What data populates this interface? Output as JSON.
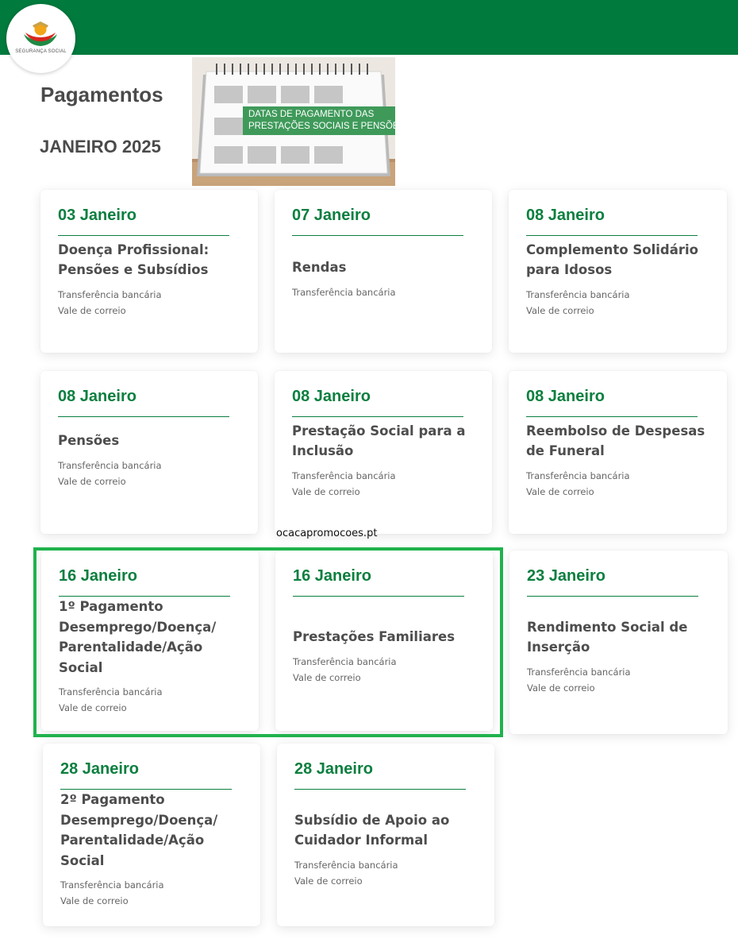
{
  "header": {
    "logo_text": "SEGURANÇA SOCIAL",
    "brand_color": "#007a3d",
    "logo_icon": "seguranca-social-logo-icon"
  },
  "page": {
    "title": "Pagamentos",
    "subtitle": "JANEIRO 2025"
  },
  "banner": {
    "caption_line1": "DATAS DE PAGAMENTO DAS",
    "caption_line2": "PRESTAÇÕES SOCIAIS E PENSÕES",
    "icon": "desk-calendar-image"
  },
  "watermark": "ocacapromocoes.pt",
  "accent_color": "#0b7f3f",
  "highlight_color": "#20b24c",
  "cards": [
    {
      "date": "03 Janeiro",
      "name": "Doença Profissional: Pensões e Subsídios",
      "methods": [
        "Transferência bancária",
        "Vale de correio"
      ]
    },
    {
      "date": "07 Janeiro",
      "name": "Rendas",
      "methods": [
        "Transferência bancária"
      ]
    },
    {
      "date": "08 Janeiro",
      "name": "Complemento Solidário para Idosos",
      "methods": [
        "Transferência bancária",
        "Vale de correio"
      ]
    },
    {
      "date": "08 Janeiro",
      "name": "Pensões",
      "methods": [
        "Transferência bancária",
        "Vale de correio"
      ]
    },
    {
      "date": "08 Janeiro",
      "name": "Prestação Social para a Inclusão",
      "methods": [
        "Transferência bancária",
        "Vale de correio"
      ]
    },
    {
      "date": "08 Janeiro",
      "name": "Reembolso de Despesas de Funeral",
      "methods": [
        "Transferência bancária",
        "Vale de correio"
      ]
    },
    {
      "date": "16 Janeiro",
      "name": "1º Pagamento Desemprego/Doença/ Parentalidade/Ação Social",
      "methods": [
        "Transferência bancária",
        "Vale de correio"
      ]
    },
    {
      "date": "16 Janeiro",
      "name": "Prestações Familiares",
      "methods": [
        "Transferência bancária",
        "Vale de correio"
      ]
    },
    {
      "date": "23 Janeiro",
      "name": "Rendimento Social de Inserção",
      "methods": [
        "Transferência bancária",
        "Vale de correio"
      ]
    },
    {
      "date": "28 Janeiro",
      "name": "2º Pagamento Desemprego/Doença/ Parentalidade/Ação Social",
      "methods": [
        "Transferência bancária",
        "Vale de correio"
      ]
    },
    {
      "date": "28 Janeiro",
      "name": "Subsídio de Apoio ao Cuidador Informal",
      "methods": [
        "Transferência bancária",
        "Vale de correio"
      ]
    }
  ]
}
